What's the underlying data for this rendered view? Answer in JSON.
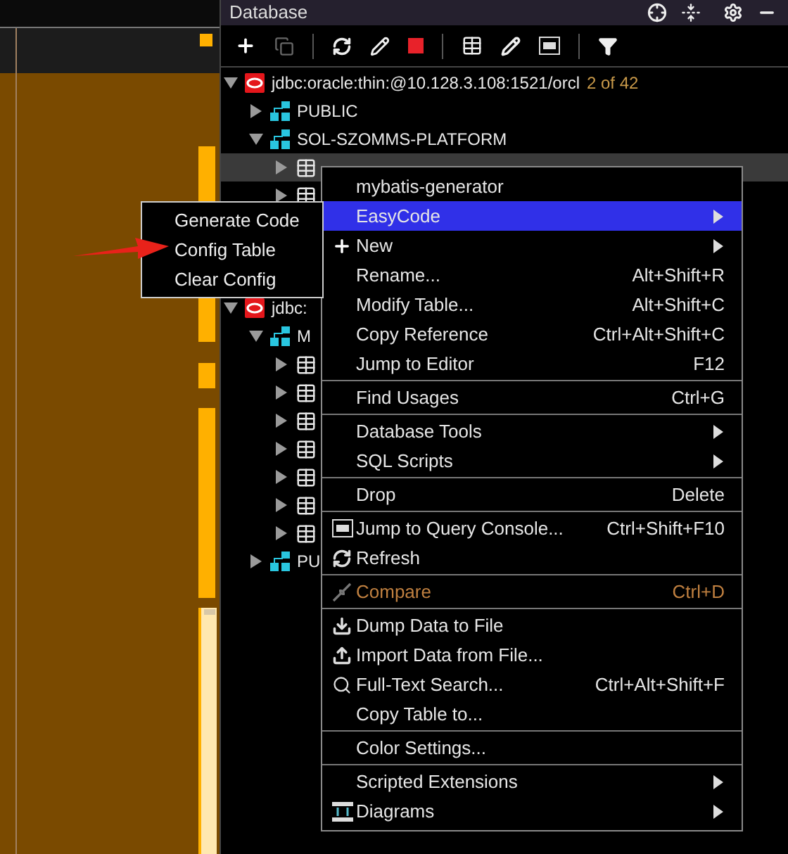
{
  "panel": {
    "title": "Database"
  },
  "tree": [
    {
      "kind": "connection",
      "label": "jdbc:oracle:thin:@10.128.3.108:1521/orcl",
      "badge": "2 of 42",
      "expanded": true,
      "children": [
        {
          "kind": "schema",
          "label": "PUBLIC",
          "expanded": false
        },
        {
          "kind": "schema",
          "label": "SOL-SZOMMS-PLATFORM",
          "expanded": true,
          "children": [
            {
              "kind": "table",
              "selected": true
            },
            {
              "kind": "table",
              "selected": false
            }
          ]
        }
      ]
    },
    {
      "kind": "connection",
      "label": "jdbc:",
      "expanded": true,
      "children": [
        {
          "kind": "schema",
          "label": "M",
          "expanded": true,
          "children": [
            {
              "kind": "table",
              "selected": false
            },
            {
              "kind": "table",
              "selected": false
            },
            {
              "kind": "table",
              "selected": false
            },
            {
              "kind": "table",
              "selected": false
            },
            {
              "kind": "table",
              "selected": false
            },
            {
              "kind": "table",
              "selected": false
            },
            {
              "kind": "table",
              "selected": false
            }
          ]
        },
        {
          "kind": "schema",
          "label": "PU",
          "expanded": false
        }
      ]
    }
  ],
  "context_menu": [
    {
      "kind": "item",
      "label": "mybatis-generator"
    },
    {
      "kind": "item",
      "label": "EasyCode",
      "submenu": true,
      "selected": true
    },
    {
      "kind": "plus",
      "label": "New",
      "submenu": true
    },
    {
      "kind": "item",
      "label": "Rename...",
      "shortcut": "Alt+Shift+R"
    },
    {
      "kind": "item",
      "label": "Modify Table...",
      "shortcut": "Alt+Shift+C"
    },
    {
      "kind": "item",
      "label": "Copy Reference",
      "shortcut": "Ctrl+Alt+Shift+C"
    },
    {
      "kind": "item",
      "label": "Jump to Editor",
      "shortcut": "F12"
    },
    {
      "kind": "separator"
    },
    {
      "kind": "item",
      "label": "Find Usages",
      "shortcut": "Ctrl+G"
    },
    {
      "kind": "separator"
    },
    {
      "kind": "item",
      "label": "Database Tools",
      "submenu": true
    },
    {
      "kind": "item",
      "label": "SQL Scripts",
      "submenu": true
    },
    {
      "kind": "separator"
    },
    {
      "kind": "item",
      "label": "Drop",
      "shortcut": "Delete"
    },
    {
      "kind": "separator"
    },
    {
      "kind": "console",
      "label": "Jump to Query Console...",
      "shortcut": "Ctrl+Shift+F10"
    },
    {
      "kind": "refresh",
      "label": "Refresh"
    },
    {
      "kind": "separator"
    },
    {
      "kind": "compare",
      "label": "Compare",
      "shortcut": "Ctrl+D",
      "disabled": true
    },
    {
      "kind": "separator"
    },
    {
      "kind": "download",
      "label": "Dump Data to File"
    },
    {
      "kind": "upload",
      "label": "Import Data from File..."
    },
    {
      "kind": "search",
      "label": "Full-Text Search...",
      "shortcut": "Ctrl+Alt+Shift+F"
    },
    {
      "kind": "item",
      "label": "Copy Table to..."
    },
    {
      "kind": "separator"
    },
    {
      "kind": "item",
      "label": "Color Settings..."
    },
    {
      "kind": "separator"
    },
    {
      "kind": "item",
      "label": "Scripted Extensions",
      "submenu": true
    },
    {
      "kind": "diagram",
      "label": "Diagrams",
      "submenu": true
    }
  ],
  "submenu": [
    {
      "label": "Generate Code"
    },
    {
      "label": "Config Table"
    },
    {
      "label": "Clear Config"
    }
  ]
}
